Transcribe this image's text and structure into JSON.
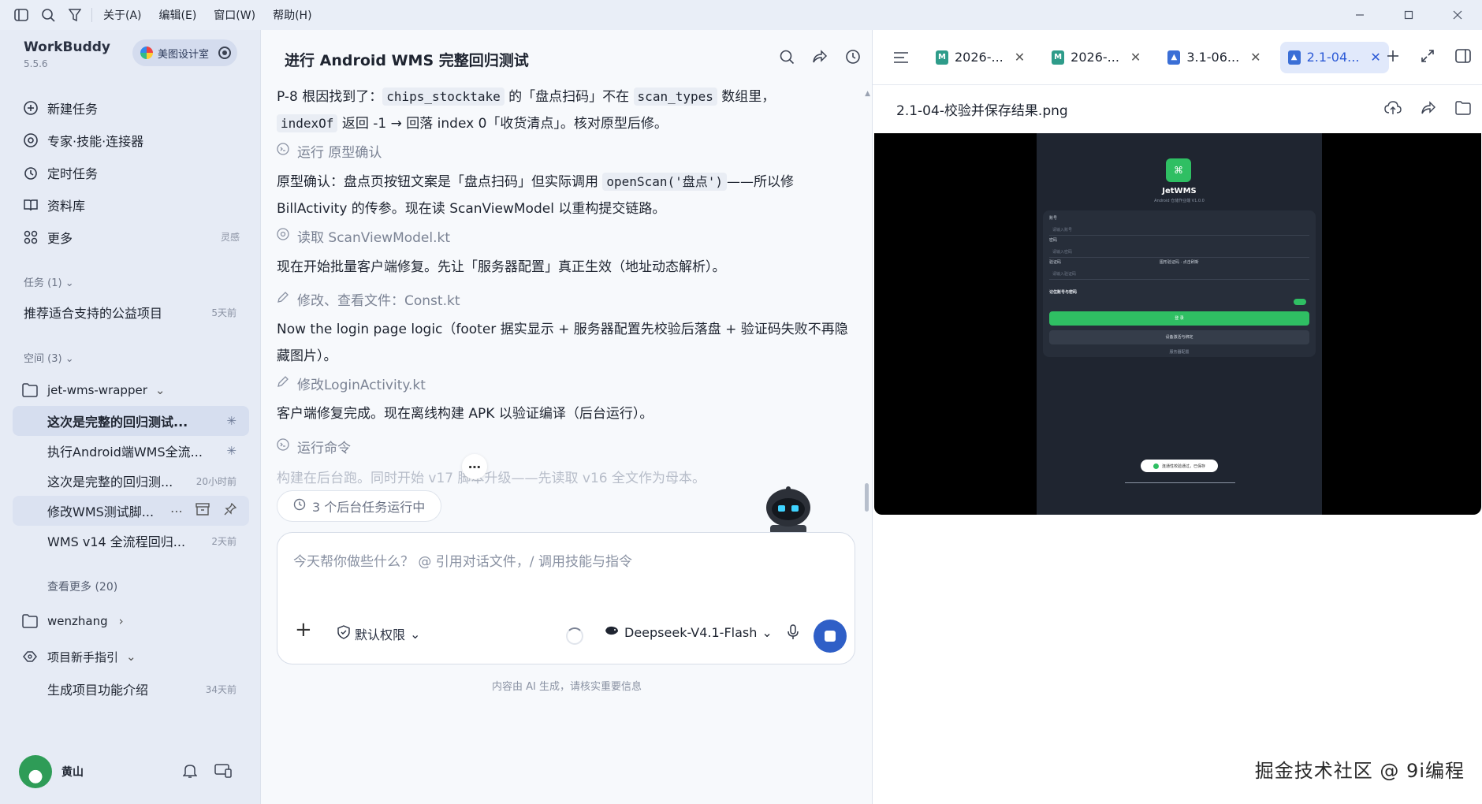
{
  "titlebar": {
    "menus": [
      "关于(A)",
      "编辑(E)",
      "窗口(W)",
      "帮助(H)"
    ]
  },
  "sidebar": {
    "app_name": "WorkBuddy",
    "version": "5.5.6",
    "org": "美图设计室",
    "nav": [
      {
        "label": "新建任务",
        "icon": "plus-circle-icon"
      },
      {
        "label": "专家·技能·连接器",
        "icon": "expert-icon"
      },
      {
        "label": "定时任务",
        "icon": "clock-icon"
      },
      {
        "label": "资料库",
        "icon": "book-icon"
      },
      {
        "label": "更多",
        "icon": "grid-icon",
        "meta": "灵感"
      }
    ],
    "tasks_header": "任务 (1)",
    "tasks": [
      {
        "label": "推荐适合支持的公益项目",
        "time": "5天前"
      }
    ],
    "spaces_header": "空间 (3)",
    "space1": {
      "name": "jet-wms-wrapper",
      "items": [
        {
          "label": "这次是完整的回归测试...",
          "state": "running"
        },
        {
          "label": "执行Android端WMS全流...",
          "state": "running"
        },
        {
          "label": "这次是完整的回归测...",
          "time": "20小时前"
        },
        {
          "label": "修改WMS测试脚...",
          "state": "hover"
        },
        {
          "label": "WMS v14 全流程回归...",
          "time": "2天前"
        }
      ],
      "more": "查看更多 (20)"
    },
    "space2": {
      "name": "wenzhang"
    },
    "space3": {
      "name": "项目新手指引",
      "items": [
        {
          "label": "生成项目功能介绍",
          "time": "34天前"
        }
      ]
    },
    "user": {
      "name": "黄山"
    }
  },
  "chat": {
    "title": "进行 Android WMS 完整回归测试",
    "m1_a": "P-8 根因找到了：",
    "m1_code1": "chips_stocktake",
    "m1_b": " 的「盘点扫码」不在 ",
    "m1_code2": "scan_types",
    "m1_c": " 数组里，",
    "m1_code3": "indexOf",
    "m1_d": " 返回 -1 → 回落 index 0「收货清点」。核对原型后修。",
    "tool1": "运行 原型确认",
    "m2_a": "原型确认：盘点页按钮文案是「盘点扫码」但实际调用 ",
    "m2_code": "openScan('盘点')",
    "m2_b": "——所以修 BillActivity 的传参。现在读 ScanViewModel 以重构提交链路。",
    "tool2": "读取 ScanViewModel.kt",
    "m3": "现在开始批量客户端修复。先让「服务器配置」真正生效（地址动态解析）。",
    "tool3": "修改、查看文件：Const.kt",
    "m4": "Now the login page logic（footer 据实显示 + 服务器配置先校验后落盘 + 验证码失败不再隐藏图片）。",
    "tool4": "修改LoginActivity.kt",
    "m5": "客户端修复完成。现在离线构建 APK 以验证编译（后台运行）。",
    "tool5": "运行命令",
    "m6": "构建在后台跑。同时开始 v17 脚本升级——先读取 v16 全文作为母本。",
    "bg_tasks": "3 个后台任务运行中",
    "composer_placeholder": "今天帮你做些什么？ @ 引用对话文件，/ 调用技能与指令",
    "permission": "默认权限",
    "model": "Deepseek-V4.1-Flash",
    "disclaimer": "内容由 AI 生成，请核实重要信息"
  },
  "right": {
    "tabs": [
      {
        "label": "2026-...",
        "type": "md"
      },
      {
        "label": "2026-...",
        "type": "md"
      },
      {
        "label": "3.1-06...",
        "type": "img"
      },
      {
        "label": "2.1-04...",
        "type": "img",
        "active": true
      }
    ],
    "file_title": "2.1-04-校验并保存结果.png",
    "preview": {
      "app_name": "JetWMS",
      "subtitle": "Android 仓储作业端 V1.0.0",
      "field1_label": "账号",
      "field1_ph": "请输入账号",
      "field2_label": "密码",
      "field2_ph": "请输入密码",
      "field3_label": "验证码",
      "field3_ph": "请输入验证码",
      "captcha_hint": "图形验证码 · 点击刷新",
      "remember": "记住账号与密码",
      "login": "登 录",
      "device": "设备激活与绑定",
      "server": "服务器配置",
      "toast": "连通性校验通过，已保存"
    }
  },
  "watermark": "掘金技术社区 @ 9i编程"
}
